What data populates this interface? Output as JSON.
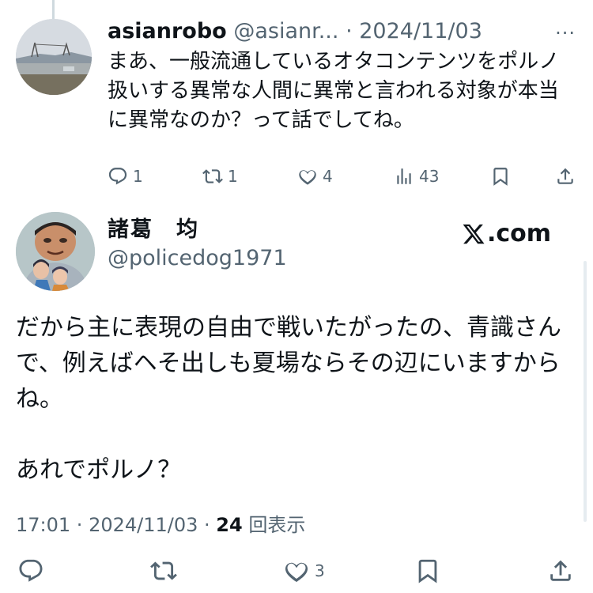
{
  "reply": {
    "name": "asianrobo",
    "handle": "@asianr...",
    "dot": " · ",
    "date": "2024/11/03",
    "text": "まあ、一般流通しているオタコンテンツをポルノ扱いする異常な人間に異常と言われる対象が本当に異常なのか？って話でしてね。",
    "actions": {
      "replies": "1",
      "reposts": "1",
      "likes": "4",
      "views": "43"
    }
  },
  "main": {
    "name": "諸葛　均",
    "handle": "@policedog1971",
    "site": ".com",
    "text": "だから主に表現の自由で戦いたがったの、青識さんで、例えばヘそ出しも夏場ならその辺にいますからね。\n\nあれでポルノ？",
    "time": "17:01",
    "dot": " · ",
    "date": "2024/11/03",
    "dot2": " · ",
    "views_count": "24",
    "views_label": " 回表示",
    "actions": {
      "likes": "3"
    }
  },
  "icons": [
    "reply-icon",
    "repost-icon",
    "like-icon",
    "views-icon",
    "bookmark-icon",
    "share-icon",
    "more-icon",
    "x-logo-icon"
  ],
  "colors": {
    "text": "#0f1419",
    "secondary": "#536471",
    "thread_line": "#cfd9de"
  }
}
